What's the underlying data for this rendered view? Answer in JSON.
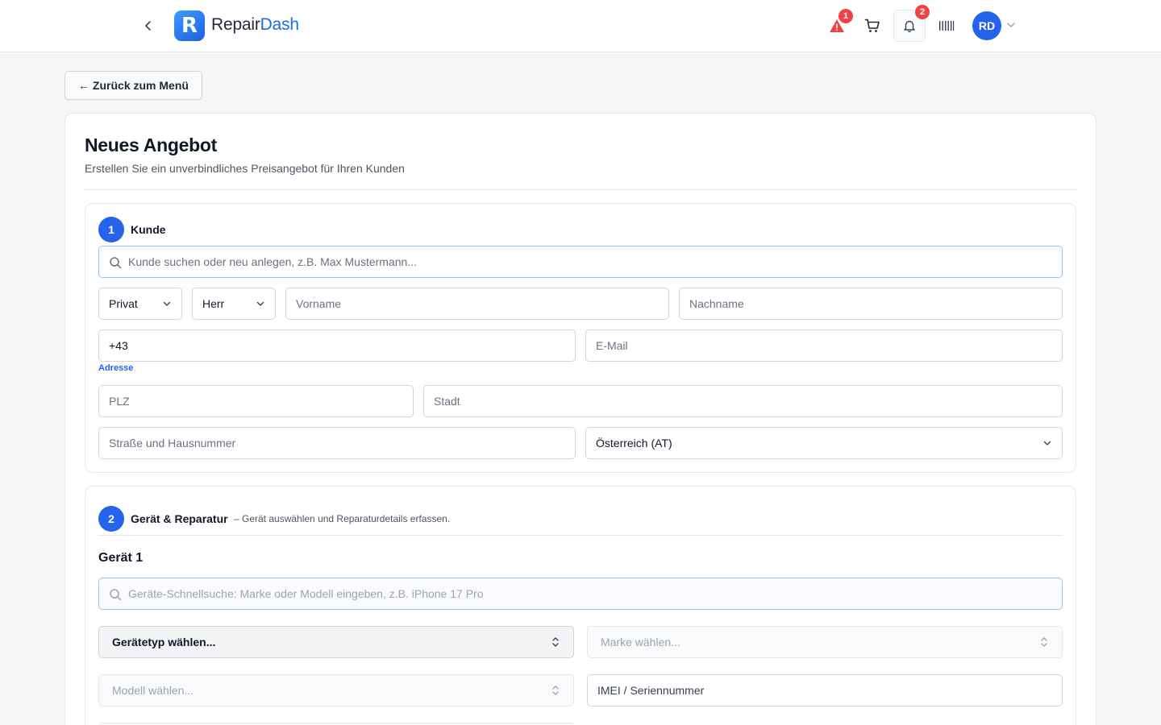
{
  "header": {
    "brand_part1": "Repair",
    "brand_part2": "Dash",
    "logo_letter": "R",
    "alert_count": "1",
    "notification_count": "2",
    "avatar_initials": "RD",
    "icons": [
      "chevron-left-icon",
      "warning-icon",
      "cart-icon",
      "bell-icon",
      "barcode-icon",
      "chevron-down-icon"
    ]
  },
  "nav": {
    "back_label": "← Zurück zum Menü"
  },
  "page": {
    "title": "Neues Angebot",
    "subtitle": "Erstellen Sie ein unverbindliches Preisangebot für Ihren Kunden"
  },
  "customer": {
    "step": "1",
    "title": "Kunde",
    "search_placeholder": "Kunde suchen oder neu anlegen, z.B. Max Mustermann...",
    "type_value": "Privat",
    "salutation_value": "Herr",
    "firstname_placeholder": "Vorname",
    "lastname_placeholder": "Nachname",
    "phone_value": "+43",
    "email_placeholder": "E-Mail",
    "address_label": "Adresse",
    "zip_placeholder": "PLZ",
    "city_placeholder": "Stadt",
    "street_placeholder": "Straße und Hausnummer",
    "country_value": "Österreich (AT)"
  },
  "device": {
    "step": "2",
    "title": "Gerät & Reparatur",
    "hint": "– Gerät auswählen und Reparaturdetails erfassen.",
    "device_title": "Gerät 1",
    "search_placeholder": "Geräte-Schnellsuche: Marke oder Modell eingeben, z.B. iPhone 17 Pro",
    "type_select": "Gerätetyp wählen...",
    "brand_select": "Marke wählen...",
    "model_select": "Modell wählen...",
    "imei_placeholder": "IMEI / Seriennummer"
  },
  "colors": {
    "accent": "#2563eb",
    "badge": "#ef4444",
    "warning": "#ef4444"
  }
}
